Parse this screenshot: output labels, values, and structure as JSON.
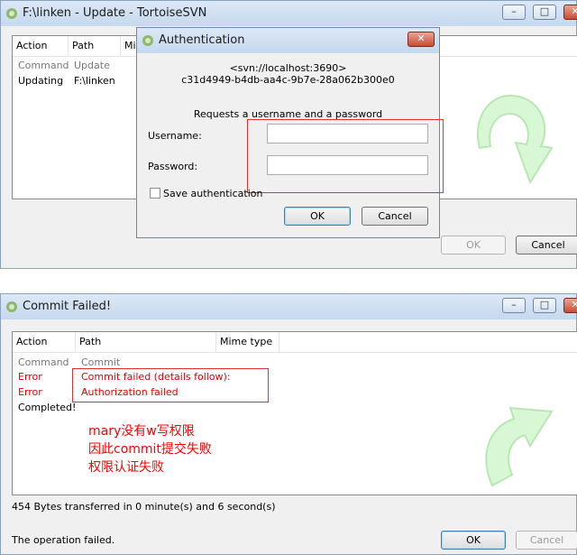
{
  "update_window": {
    "title": "F:\\linken - Update - TortoiseSVN",
    "columns": [
      "Action",
      "Path",
      "Mi"
    ],
    "rows": [
      {
        "action": "Command",
        "path": "Update"
      },
      {
        "action": "Updating",
        "path": "F:\\linken"
      }
    ],
    "ok_label": "OK",
    "cancel_label": "Cancel"
  },
  "auth_dialog": {
    "title": "Authentication",
    "server": "<svn://localhost:3690>",
    "uuid": "c31d4949-b4db-aa4c-9b7e-28a062b300e0",
    "prompt": "Requests a username and a password",
    "username_label": "Username:",
    "username_value": "",
    "password_label": "Password:",
    "password_value": "",
    "save_label": "Save authentication",
    "ok_label": "OK",
    "cancel_label": "Cancel"
  },
  "commit_window": {
    "title": "Commit Failed!",
    "columns": [
      "Action",
      "Path",
      "Mime type"
    ],
    "rows": [
      {
        "action": "Command",
        "path": "Commit"
      },
      {
        "action": "Error",
        "path": "Commit failed (details follow):"
      },
      {
        "action": "Error",
        "path": "Authorization failed"
      },
      {
        "action": "Completed!",
        "path": ""
      }
    ],
    "annotation": [
      "mary没有w写权限",
      "因此commit提交失败",
      "权限认证失败"
    ],
    "transfer_text": "454 Bytes transferred in 0 minute(s) and 6 second(s)",
    "status_text": "The operation failed.",
    "ok_label": "OK",
    "cancel_label": "Cancel"
  },
  "colors": {
    "error": "#e00000",
    "annotation": "#ff0000",
    "arrow": "#c6f3c2"
  }
}
